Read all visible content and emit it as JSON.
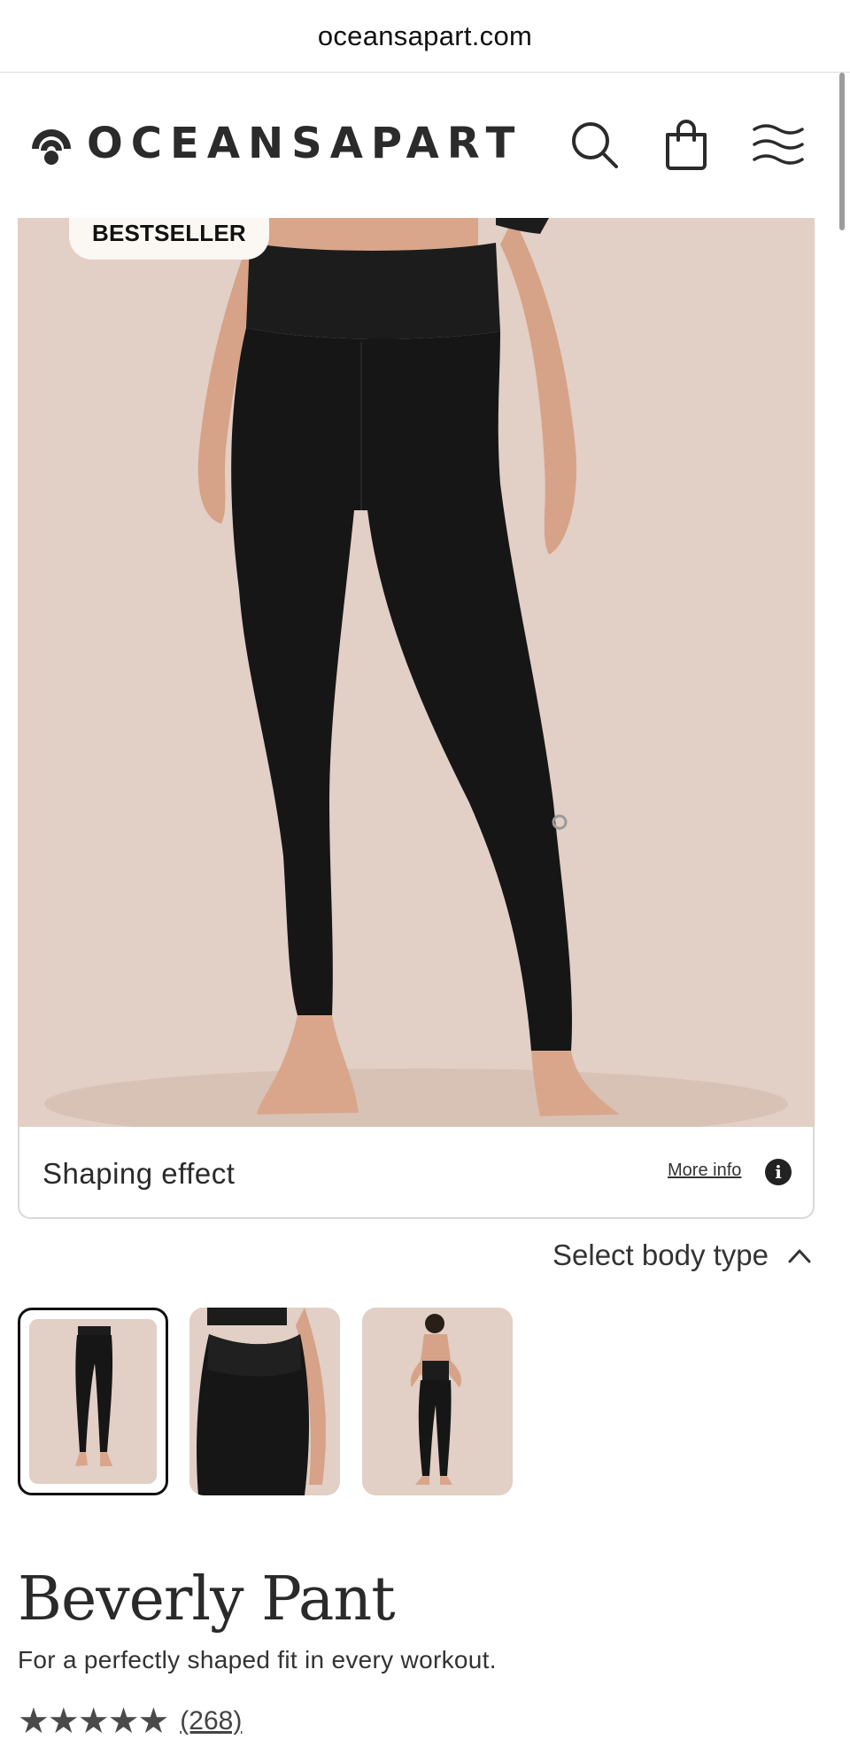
{
  "browser": {
    "url": "oceansapart.com"
  },
  "header": {
    "brand": "OCEANSAPART",
    "icons": [
      "search-icon",
      "shopping-bag-icon",
      "menu-waves-icon"
    ]
  },
  "gallery": {
    "badge": "BESTSELLER",
    "feature_title": "Shaping effect",
    "more_info": "More info",
    "info_symbol": "i",
    "body_type_label": "Select body type",
    "thumbnails": 3,
    "selected_thumbnail": 1
  },
  "product": {
    "name": "Beverly Pant",
    "tagline": "For a perfectly shaped fit in every workout.",
    "stars_display": "★★★★★",
    "rating": 4.5,
    "review_count": "(268)"
  },
  "colors": {
    "backdrop": "#e2cfc5",
    "leggings": "#161616",
    "skin": "#d9a68c"
  }
}
